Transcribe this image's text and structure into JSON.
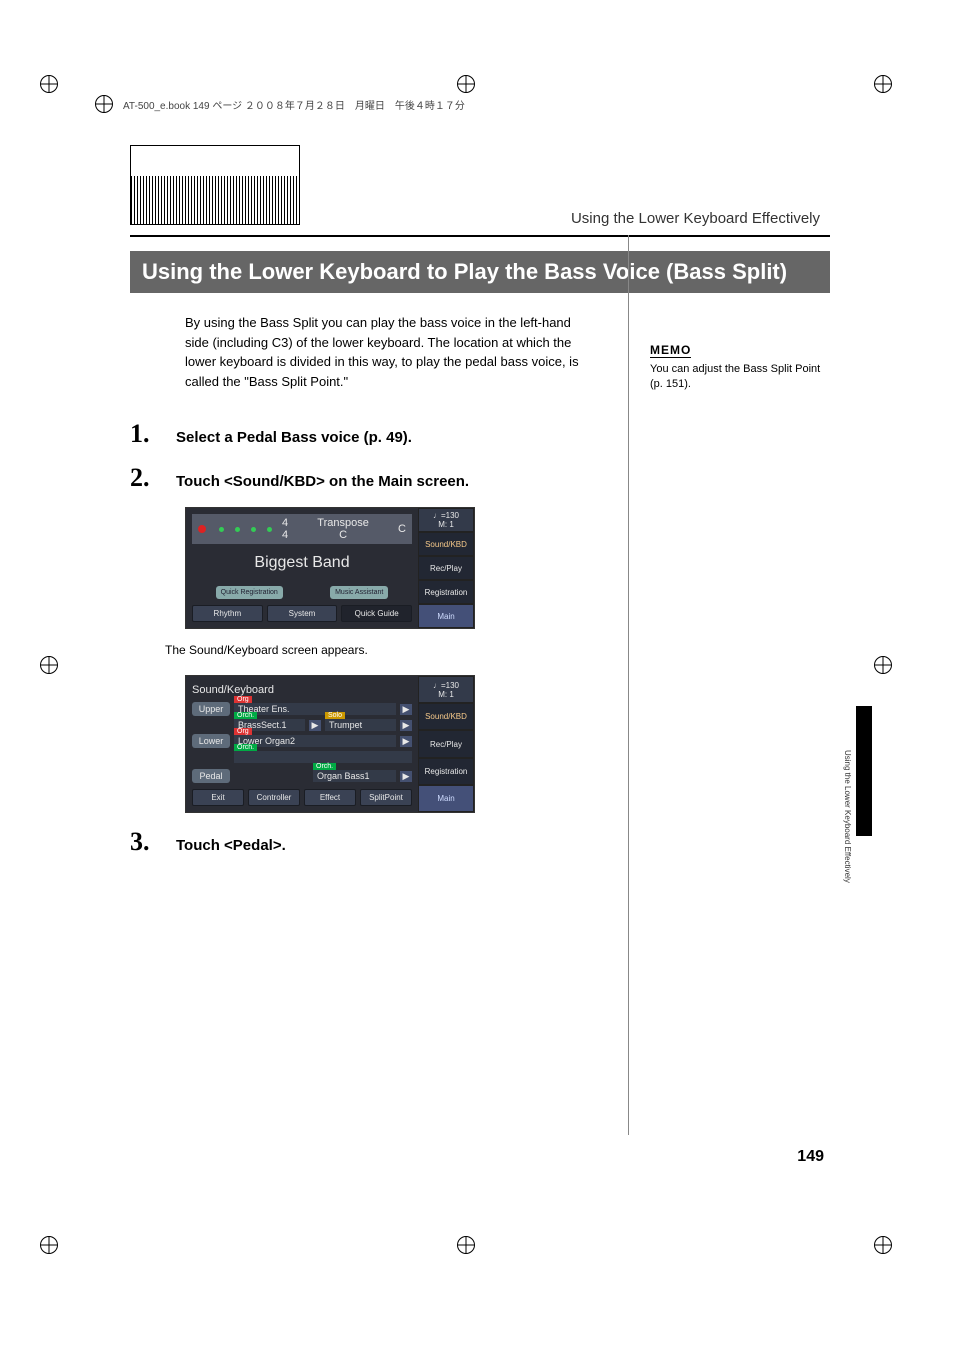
{
  "header_strip": "AT-500_e.book  149 ページ  ２００８年７月２８日　月曜日　午後４時１７分",
  "chapter_right": "Using the Lower Keyboard Effectively",
  "section_title": "Using the Lower Keyboard to Play the Bass Voice (Bass Split)",
  "intro": "By using the Bass Split you can play the bass voice in the left-hand side (including C3) of the lower keyboard. The location at which the lower keyboard is divided in this way, to play the pedal bass voice, is called the \"Bass Split Point.\"",
  "memo_label": "MEMO",
  "memo_text": "You can adjust the Bass Split Point (p. 151).",
  "steps": {
    "1": {
      "num": "1.",
      "text": "Select a Pedal Bass voice (p. 49)."
    },
    "2": {
      "num": "2.",
      "text": "Touch <Sound/KBD> on the Main screen."
    },
    "3": {
      "num": "3.",
      "text": "Touch <Pedal>."
    }
  },
  "caption1": "The Sound/Keyboard screen appears.",
  "screen1": {
    "time_sig": "4\n4",
    "transpose_lbl": "Transpose",
    "transpose_val": "C",
    "tempo": "♩=130",
    "meas": "M:    1",
    "title": "Biggest Band",
    "quick_reg": "Quick Registration",
    "music_asst": "Music Assistant",
    "btm": {
      "rhythm": "Rhythm",
      "system": "System",
      "quick": "Quick Guide"
    },
    "side": {
      "sk": "Sound/KBD",
      "rp": "Rec/Play",
      "reg": "Registration",
      "main": "Main"
    }
  },
  "screen2": {
    "title": "Sound/Keyboard",
    "tempo": "♩=130",
    "meas": "M:    1",
    "upper": "Upper",
    "lower": "Lower",
    "pedal": "Pedal",
    "upper_org": "Theater Ens.",
    "upper_orch": "BrassSect.1",
    "upper_solo": "Trumpet",
    "lower_org": "Lower Organ2",
    "pedal_orch": "Organ Bass1",
    "btm": {
      "exit": "Exit",
      "ctrl": "Controller",
      "fx": "Effect",
      "sp": "SplitPoint"
    },
    "side": {
      "sk": "Sound/KBD",
      "rp": "Rec/Play",
      "reg": "Registration",
      "main": "Main"
    },
    "tags": {
      "org": "Org",
      "orch": "Orch.",
      "solo": "Solo"
    }
  },
  "side_tab_text": "Using the Lower Keyboard Effectively",
  "page_num": "149"
}
